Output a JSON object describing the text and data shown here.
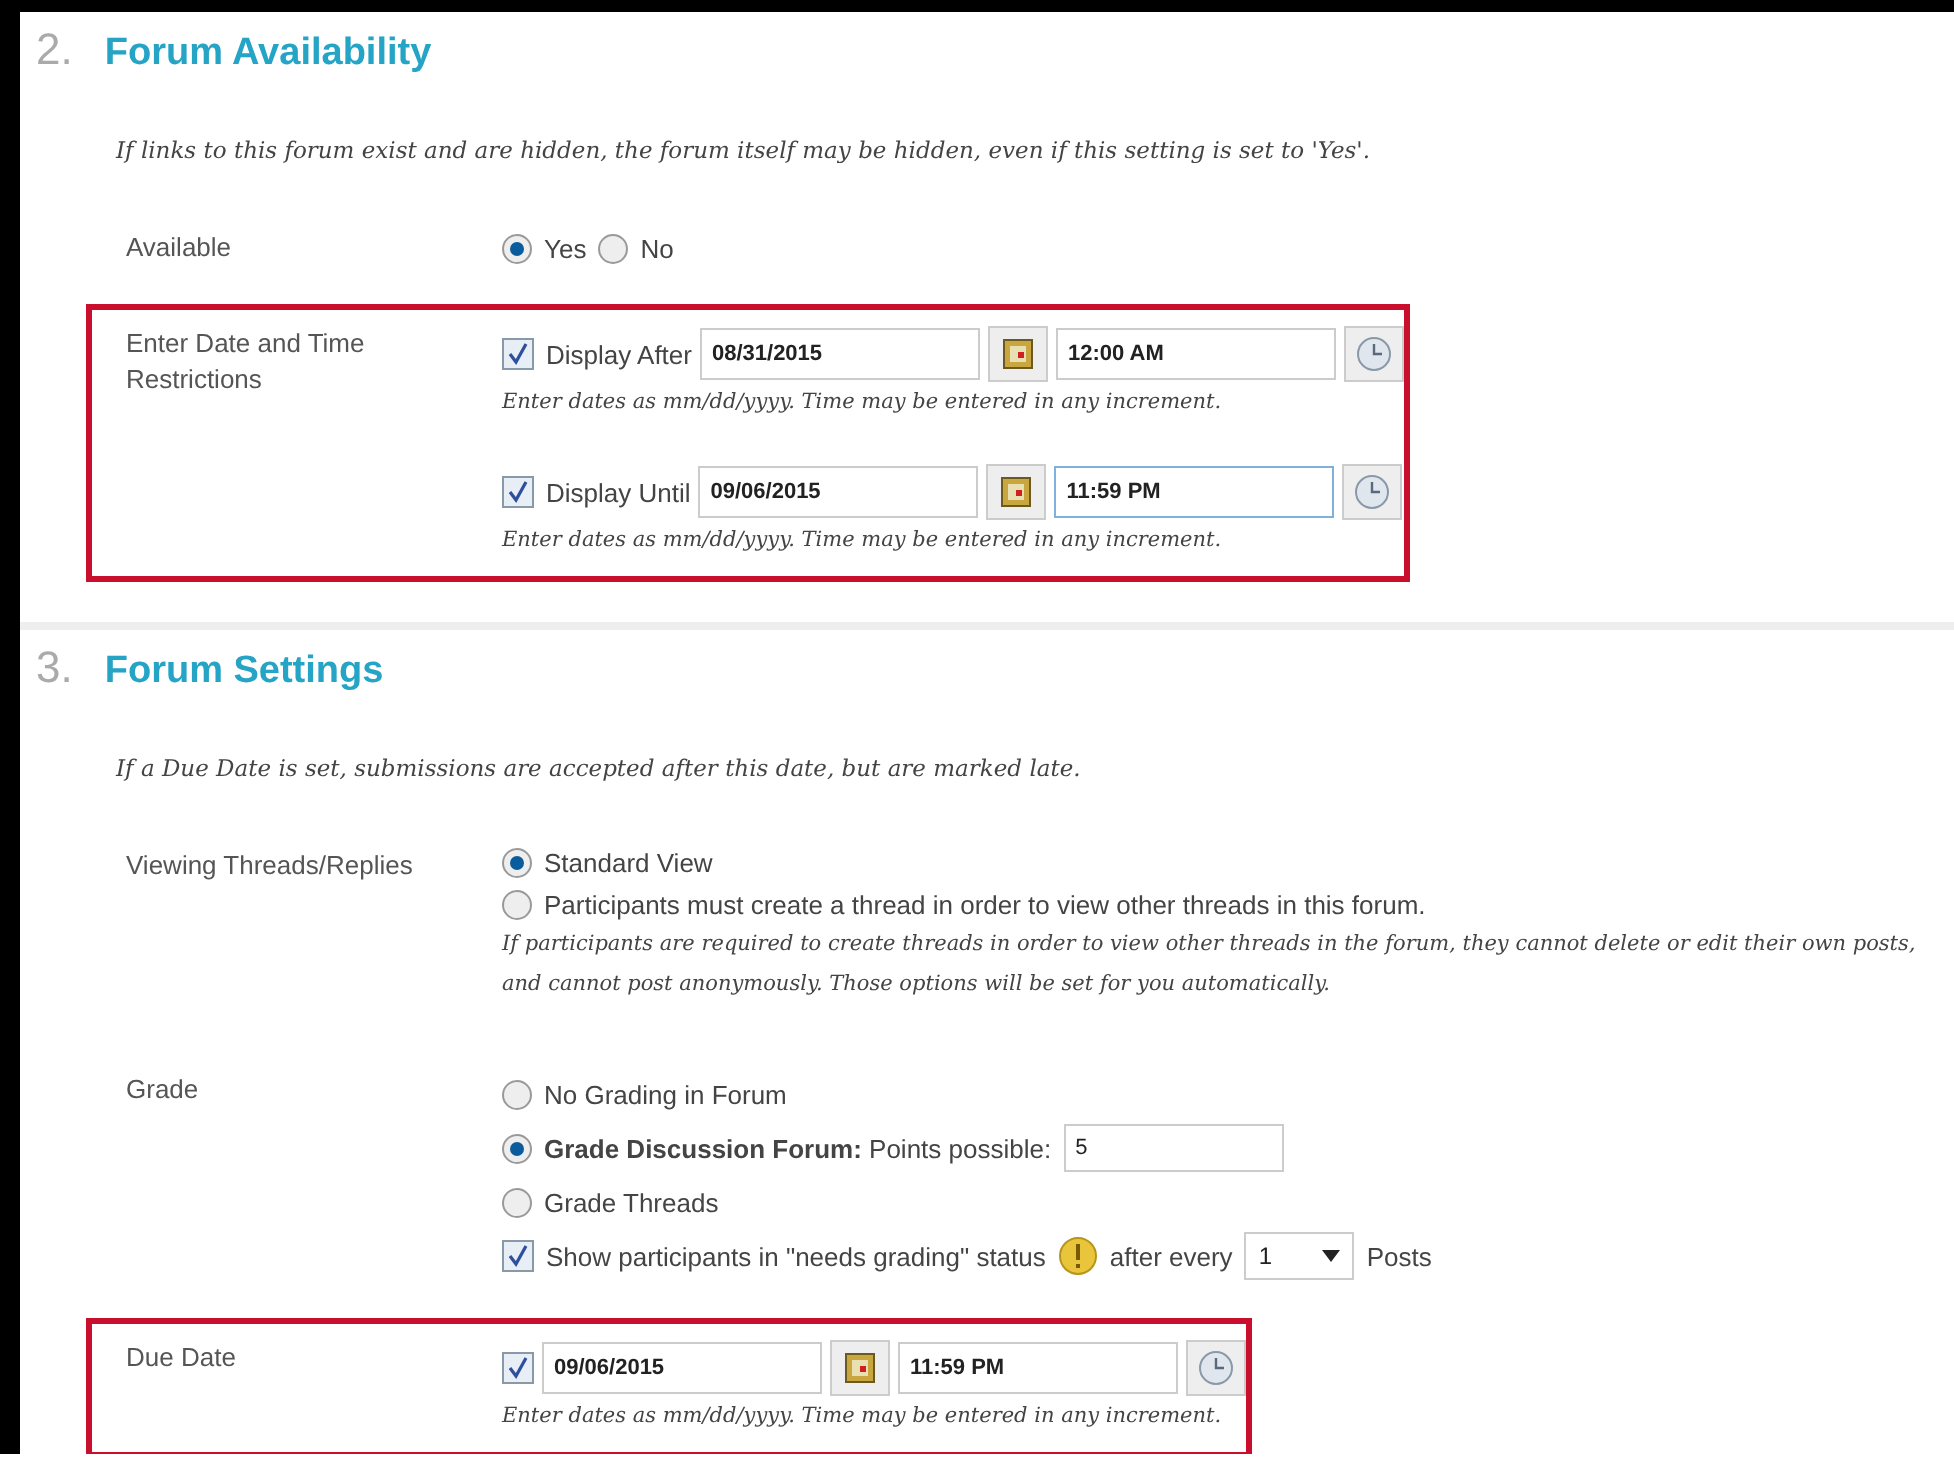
{
  "sections": [
    {
      "number": "2.",
      "title": "Forum Availability",
      "instructions": "If links to this forum exist and are hidden, the forum itself may be hidden, even if this setting is set to 'Yes'.",
      "rows": [
        {
          "kind": "radio-inline",
          "label": "Available",
          "highlighted": false,
          "options": [
            {
              "label": "Yes",
              "selected": true
            },
            {
              "label": "No",
              "selected": false
            }
          ]
        },
        {
          "kind": "dates",
          "label": "Enter Date and Time Restrictions",
          "highlighted": true,
          "entries": [
            {
              "checked": true,
              "label": "Display After",
              "date": "08/31/2015",
              "time": "12:00 AM",
              "focused": false,
              "hint": "Enter dates as mm/dd/yyyy. Time may be entered in any increment."
            },
            {
              "checked": true,
              "label": "Display Until",
              "date": "09/06/2015",
              "time": "11:59 PM",
              "focused": true,
              "hint": "Enter dates as mm/dd/yyyy. Time may be entered in any increment."
            }
          ]
        }
      ]
    },
    {
      "number": "3.",
      "title": "Forum Settings",
      "instructions": "If a Due Date is set, submissions are accepted after this date, but are marked late.",
      "rows": [
        {
          "kind": "radio-stack",
          "label": "Viewing Threads/Replies",
          "highlighted": false,
          "options": [
            {
              "label": "Standard View",
              "selected": true
            },
            {
              "label": "Participants must create a thread in order to view other threads in this forum.",
              "selected": false
            }
          ],
          "hint": "If participants are required to create threads in order to view other threads in the forum, they cannot delete or edit their own posts, and cannot post anonymously. Those options will be set for you automatically."
        },
        {
          "kind": "grade",
          "label": "Grade",
          "highlighted": false,
          "options": [
            {
              "label": "No Grading in Forum",
              "selected": false
            },
            {
              "label": "**Grade Discussion Forum:** Points possible:",
              "selected": true,
              "points": "5"
            },
            {
              "label": "Grade Threads",
              "selected": false
            }
          ],
          "needs_grading": {
            "checked": true,
            "label": "Show participants in \"needs grading\" status",
            "after": "after every",
            "every": "1",
            "unit": "Posts"
          }
        },
        {
          "kind": "dates",
          "label": "Due Date",
          "highlighted": true,
          "entries": [
            {
              "checked": true,
              "date": "09/06/2015",
              "time": "11:59 PM",
              "focused": false,
              "hint": "Enter dates as mm/dd/yyyy. Time may be entered in any increment."
            }
          ]
        }
      ]
    }
  ]
}
